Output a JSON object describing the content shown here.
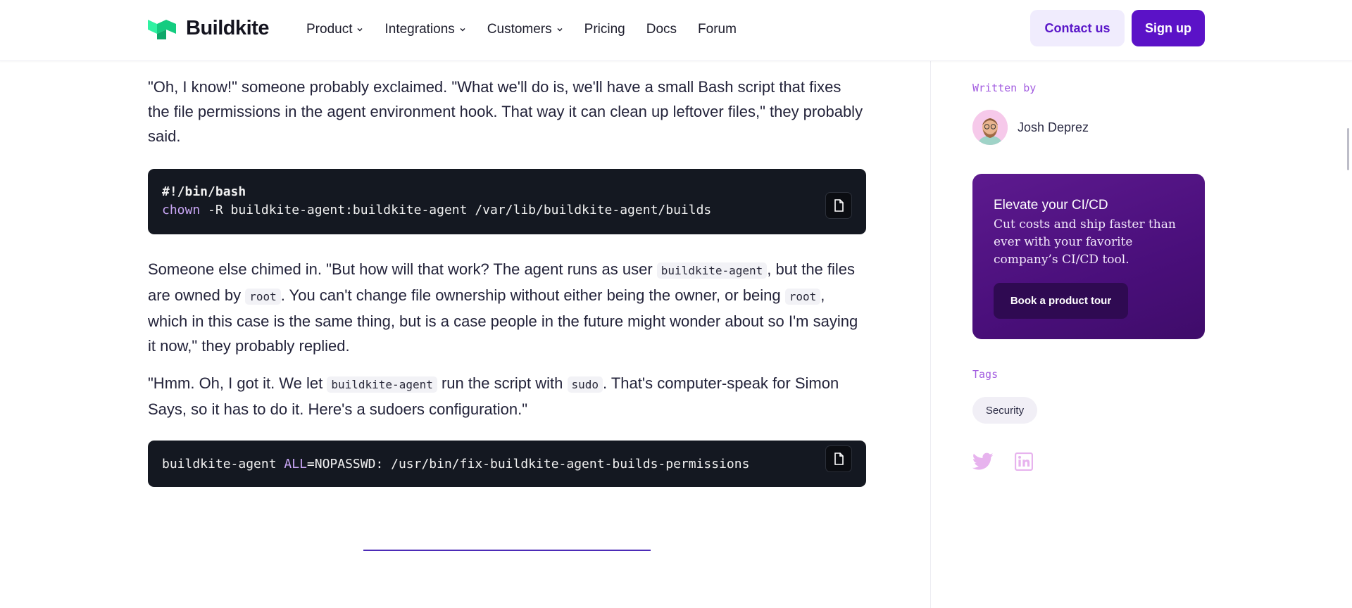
{
  "header": {
    "logo_text": "Buildkite",
    "nav": [
      {
        "label": "Product",
        "has_dropdown": true
      },
      {
        "label": "Integrations",
        "has_dropdown": true
      },
      {
        "label": "Customers",
        "has_dropdown": true
      },
      {
        "label": "Pricing",
        "has_dropdown": false
      },
      {
        "label": "Docs",
        "has_dropdown": false
      },
      {
        "label": "Forum",
        "has_dropdown": false
      }
    ],
    "contact_label": "Contact us",
    "signup_label": "Sign up"
  },
  "article": {
    "p1": "\"Oh, I know!\" someone probably exclaimed. \"What we'll do is, we'll have a small Bash script that fixes the file permissions in the agent environment hook. That way it can clean up leftover files,\" they probably said.",
    "code1": {
      "line1": "#!/bin/bash",
      "line2_kw": "chown",
      "line2_rest": " -R buildkite-agent:buildkite-agent /var/lib/buildkite-agent/builds"
    },
    "p2": {
      "t1": "Someone else chimed in. \"But how will that work? The agent runs as user ",
      "c1": "buildkite-agent",
      "t2": ", but the files are owned by ",
      "c2": "root",
      "t3": ". You can't change file ownership without either being the owner, or being ",
      "c3": "root",
      "t4": ", which in this case is the same thing, but is a case people in the future might wonder about so I'm saying it now,\" they probably replied."
    },
    "p3": {
      "t1": "\"Hmm. Oh, I got it. We let ",
      "c1": "buildkite-agent",
      "t2": " run the script with ",
      "c2": "sudo",
      "t3": ". That's computer-speak for Simon Says, so it has to do it. Here's a sudoers configuration.\""
    },
    "code2": {
      "pre": "buildkite-agent ",
      "kw": "ALL",
      "post": "=NOPASSWD: /usr/bin/fix-buildkite-agent-builds-permissions"
    }
  },
  "sidebar": {
    "written_by_label": "Written by",
    "author_name": "Josh Deprez",
    "promo": {
      "title": "Elevate your CI/CD",
      "text": "Cut costs and ship faster than ever with your favorite company’s CI/CD tool.",
      "button": "Book a product tour"
    },
    "tags_label": "Tags",
    "tags": [
      "Security"
    ],
    "social": [
      "twitter-icon",
      "linkedin-icon"
    ]
  },
  "colors": {
    "brand_purple": "#5b12c7",
    "accent_label": "#a35de0",
    "code_bg": "#141821",
    "logo_green": "#14cc80"
  }
}
